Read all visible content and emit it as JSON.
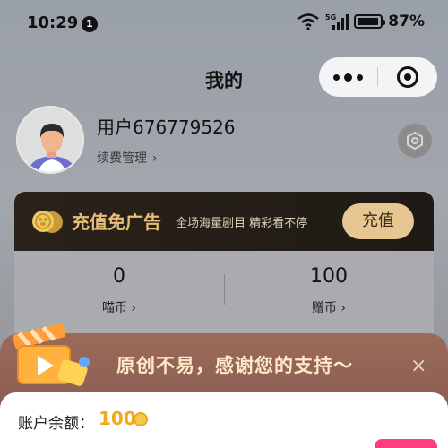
{
  "status_bar": {
    "time": "10:29",
    "notification_badge": "1",
    "network": "5G",
    "battery": "87%"
  },
  "header": {
    "title": "我的",
    "capsule": {
      "more_icon": "more-dots-icon",
      "close_icon": "target-icon"
    }
  },
  "user": {
    "name": "用户676779526",
    "renewal_label": "续费管理",
    "renewal_chevron": "›"
  },
  "vip_banner": {
    "title": "充值免广告",
    "subtitle": "全场海量剧目 精彩看不停",
    "button_label": "充值"
  },
  "balance": {
    "coins_value": "0",
    "coins_label": "喵币",
    "gift_value": "100",
    "gift_label": "赠币",
    "chevron": "›"
  },
  "support_popup": {
    "message": "原创不易，感谢您的支持～",
    "close": "×"
  },
  "account": {
    "label": "账户余额：",
    "value": "100"
  },
  "colors": {
    "gold": "#e7bd78",
    "orange_value": "#f2a81d",
    "tag_pink": "#ff3d7f"
  }
}
